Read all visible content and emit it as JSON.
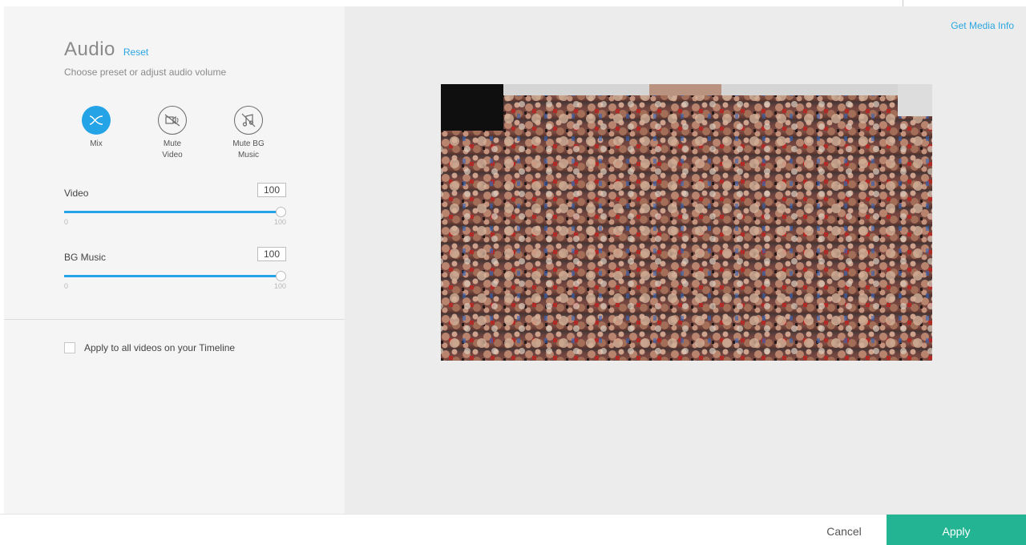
{
  "audio_panel": {
    "title": "Audio",
    "reset_label": "Reset",
    "subtitle": "Choose preset or adjust audio volume",
    "presets": [
      {
        "label_line1": "Mix",
        "label_line2": "",
        "icon": "mix-icon",
        "active": true
      },
      {
        "label_line1": "Mute",
        "label_line2": "Video",
        "icon": "mute-video-icon",
        "active": false
      },
      {
        "label_line1": "Mute BG",
        "label_line2": "Music",
        "icon": "mute-music-icon",
        "active": false
      }
    ],
    "video_volume": {
      "label": "Video",
      "value": "100",
      "min_label": "0",
      "max_label": "100",
      "level": 1.0
    },
    "bg_music_volume": {
      "label": "BG Music",
      "value": "100",
      "min_label": "0",
      "max_label": "100",
      "level": 1.0
    },
    "apply_all_label": "Apply to all videos on your Timeline",
    "apply_all_checked": false
  },
  "preview": {
    "media_info_label": "Get Media Info",
    "video_frame": "crowd-video-frame"
  },
  "footer": {
    "cancel_label": "Cancel",
    "apply_label": "Apply"
  },
  "colors": {
    "accent": "#24a3e6",
    "apply": "#23b493",
    "left_panel_bg": "#f5f5f5",
    "preview_bg": "#ececec"
  }
}
